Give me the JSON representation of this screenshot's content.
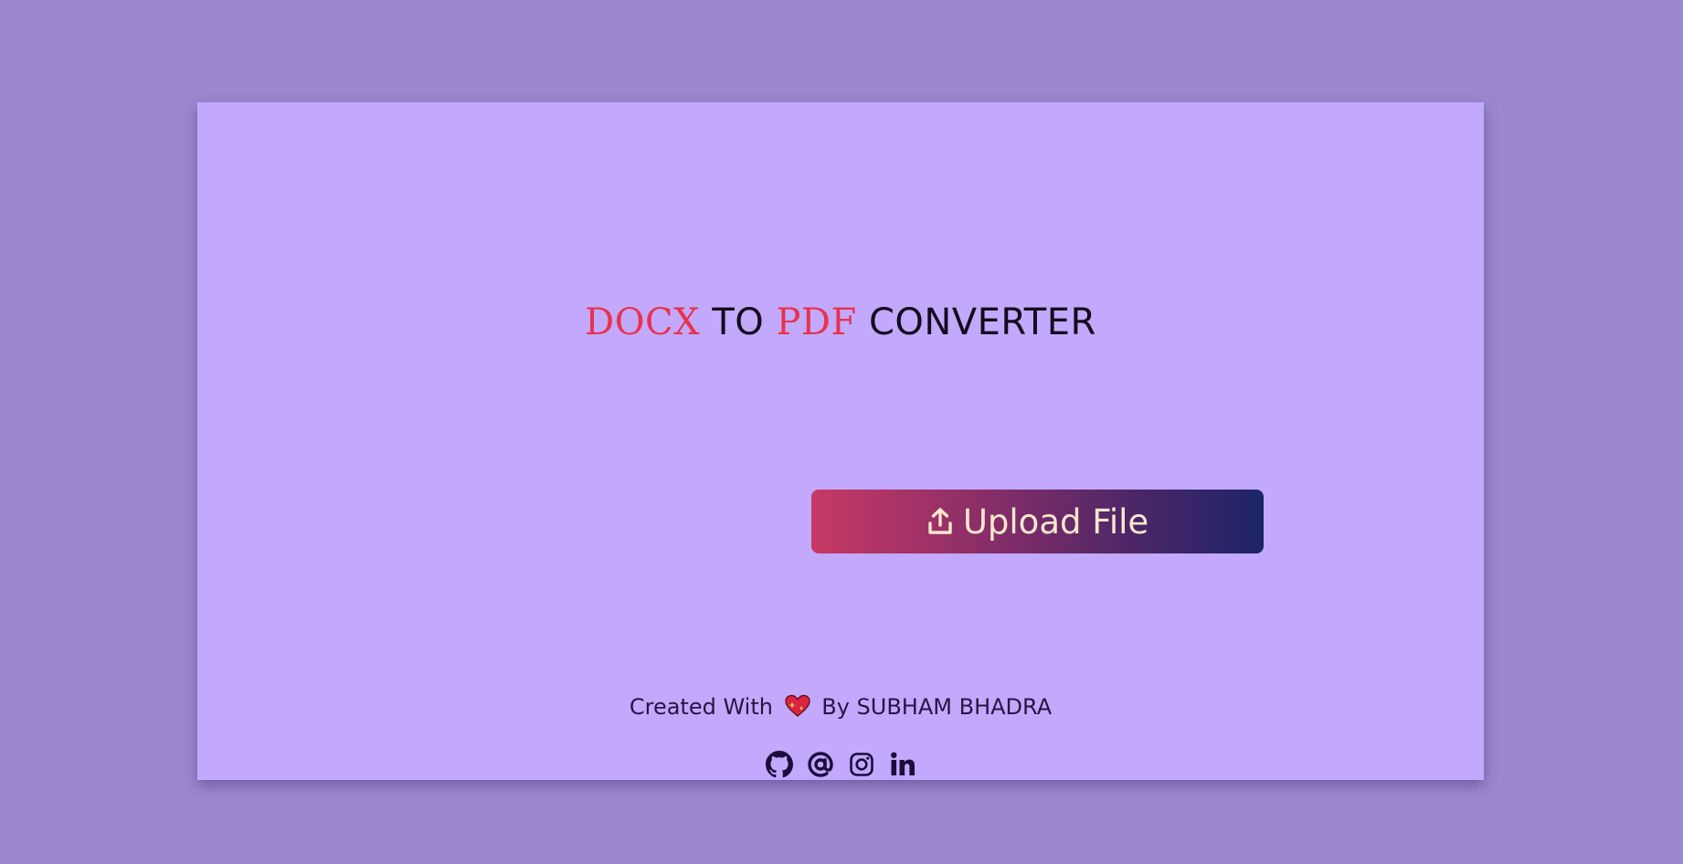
{
  "colors": {
    "page_background": "#9b88cf",
    "card_background": "#c2a9fe",
    "title_accent": "#e8324f",
    "title_text": "#140a1e",
    "button_gradient_start": "#c73965",
    "button_gradient_end": "#1c2568",
    "button_text": "#fbe6cd",
    "footer_text": "#2a1444",
    "social_icon": "#1e0c3d"
  },
  "title": {
    "part1": "DOCX",
    "part2": " TO ",
    "part3": "PDF",
    "part4": " CONVERTER"
  },
  "upload": {
    "label": "Upload File",
    "icon": "upload-icon"
  },
  "footer": {
    "prefix": "Created With",
    "heart_icon": "sparkling-heart-icon",
    "suffix": "By SUBHAM BHADRA",
    "social_icons": [
      "github-icon",
      "at-sign-icon",
      "instagram-icon",
      "linkedin-icon"
    ]
  }
}
